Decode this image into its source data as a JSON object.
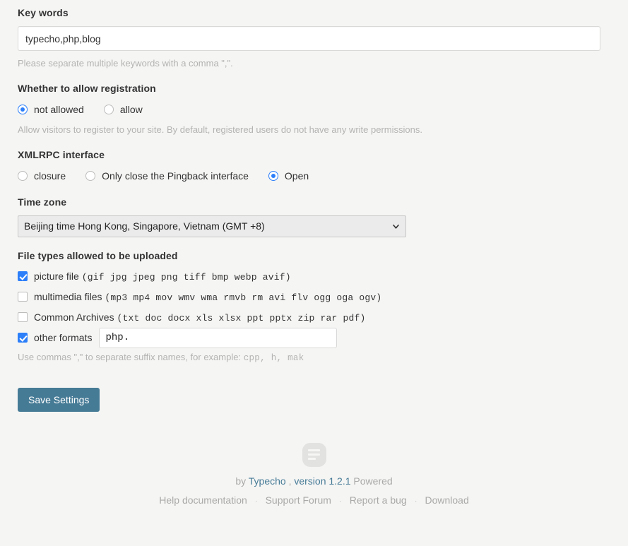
{
  "keywords": {
    "label": "Key words",
    "value": "typecho,php,blog",
    "hint": "Please separate multiple keywords with a comma \",\"."
  },
  "registration": {
    "label": "Whether to allow registration",
    "options": [
      {
        "label": "not allowed",
        "selected": true
      },
      {
        "label": "allow",
        "selected": false
      }
    ],
    "hint": "Allow visitors to register to your site. By default, registered users do not have any write permissions."
  },
  "xmlrpc": {
    "label": "XMLRPC interface",
    "options": [
      {
        "label": "closure",
        "selected": false
      },
      {
        "label": "Only close the Pingback interface",
        "selected": false
      },
      {
        "label": "Open",
        "selected": true
      }
    ]
  },
  "timezone": {
    "label": "Time zone",
    "value": "Beijing time Hong Kong, Singapore, Vietnam (GMT +8)",
    "options": [
      "Beijing time Hong Kong, Singapore, Vietnam (GMT +8)"
    ]
  },
  "filetypes": {
    "label": "File types allowed to be uploaded",
    "items": [
      {
        "label": "picture file",
        "extensions": "(gif jpg jpeg png tiff bmp webp avif)",
        "checked": true
      },
      {
        "label": "multimedia files",
        "extensions": "(mp3 mp4 mov wmv wma rmvb rm avi flv ogg oga ogv)",
        "checked": false
      },
      {
        "label": "Common Archives",
        "extensions": "(txt doc docx xls xlsx ppt pptx zip rar pdf)",
        "checked": false
      }
    ],
    "other": {
      "label": "other formats",
      "checked": true,
      "value": "php."
    },
    "hint_prefix": "Use commas \",\" to separate suffix names, for example:",
    "hint_mono": "cpp, h, mak"
  },
  "save_button": "Save Settings",
  "footer": {
    "logo_icon": "typecho-logo-icon",
    "powered_by": "by",
    "brand": "Typecho",
    "comma": ",",
    "version": "version 1.2.1",
    "powered_suffix": "Powered",
    "links": [
      "Help documentation",
      "Support Forum",
      "Report a bug",
      "Download"
    ],
    "separator": "·"
  },
  "colors": {
    "accent_blue": "#2d7ff9",
    "button_blue": "#467b96",
    "page_bg": "#f5f5f4",
    "muted_text": "#b3b3b1"
  }
}
